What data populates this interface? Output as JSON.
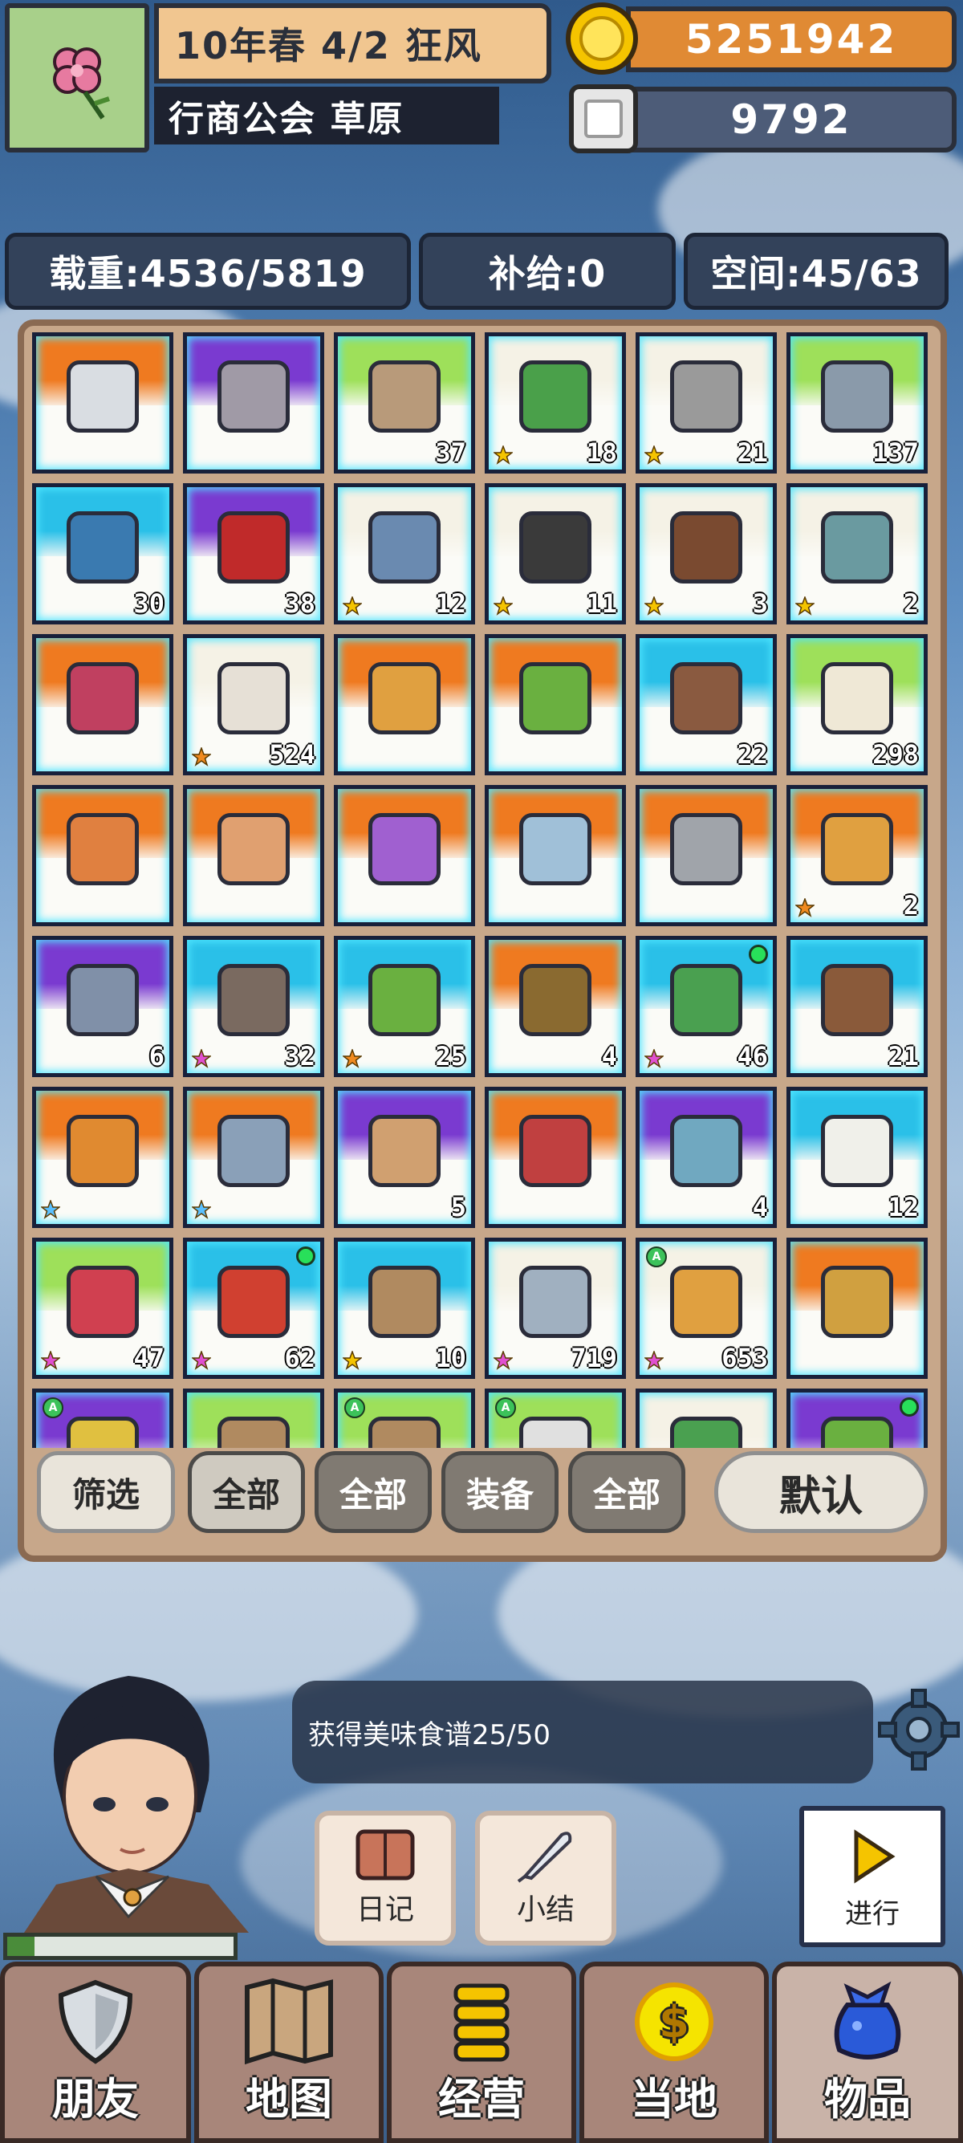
{
  "header": {
    "date_weather": "10年春 4/2 狂风",
    "location": "行商公会 草原",
    "gold": "5251942",
    "silver": "9792"
  },
  "stats": {
    "weight": "载重:4536/5819",
    "supply": "补给:0",
    "space": "空间:45/63"
  },
  "inventory": {
    "items": [
      {
        "count": "",
        "star": "",
        "dot": false,
        "a": false,
        "top": "#ef7a20",
        "icon": "#d9dde2",
        "name": "ring-item"
      },
      {
        "count": "",
        "star": "",
        "dot": false,
        "a": false,
        "top": "#7a3ad0",
        "icon": "#a09aa6",
        "name": "scroll-item"
      },
      {
        "count": "37",
        "star": "",
        "dot": false,
        "a": false,
        "top": "#9ee05a",
        "icon": "#b89a7a",
        "name": "rune-stone-item"
      },
      {
        "count": "18",
        "star": "gold",
        "dot": false,
        "a": false,
        "top": "#f5f2e6",
        "icon": "#4aa04a",
        "name": "book-item"
      },
      {
        "count": "21",
        "star": "gold",
        "dot": false,
        "a": false,
        "top": "#f5f2e6",
        "icon": "#9a9a9a",
        "name": "safe-item"
      },
      {
        "count": "137",
        "star": "",
        "dot": false,
        "a": false,
        "top": "#9ee05a",
        "icon": "#8a9aaa",
        "name": "rune-stone-item"
      },
      {
        "count": "30",
        "star": "",
        "dot": false,
        "a": false,
        "top": "#2ac0e8",
        "icon": "#3a7ab0",
        "name": "ticket-item"
      },
      {
        "count": "38",
        "star": "",
        "dot": false,
        "a": false,
        "top": "#7a3ad0",
        "icon": "#c02a2a",
        "name": "scroll-item"
      },
      {
        "count": "12",
        "star": "gold",
        "dot": false,
        "a": false,
        "top": "#f5f2e6",
        "icon": "#6a8ab0",
        "name": "book-item"
      },
      {
        "count": "11",
        "star": "gold",
        "dot": false,
        "a": false,
        "top": "#f5f2e6",
        "icon": "#3a3a3a",
        "name": "book-item"
      },
      {
        "count": "3",
        "star": "gold",
        "dot": false,
        "a": false,
        "top": "#f5f2e6",
        "icon": "#7a4a30",
        "name": "book-item"
      },
      {
        "count": "2",
        "star": "gold",
        "dot": false,
        "a": false,
        "top": "#f5f2e6",
        "icon": "#6a9aa0",
        "name": "book-item"
      },
      {
        "count": "",
        "star": "",
        "dot": false,
        "a": false,
        "top": "#ef7a20",
        "icon": "#c04060",
        "name": "ring-item"
      },
      {
        "count": "524",
        "star": "orange",
        "dot": false,
        "a": false,
        "top": "#f5f2e6",
        "icon": "#e6e0d6",
        "name": "medkit-item"
      },
      {
        "count": "",
        "star": "",
        "dot": false,
        "a": false,
        "top": "#ef7a20",
        "icon": "#e0a040",
        "name": "scroll-item"
      },
      {
        "count": "",
        "star": "",
        "dot": false,
        "a": false,
        "top": "#ef7a20",
        "icon": "#6ab040",
        "name": "ring-item"
      },
      {
        "count": "22",
        "star": "",
        "dot": false,
        "a": false,
        "top": "#2ac0e8",
        "icon": "#8a5a40",
        "name": "shell-item"
      },
      {
        "count": "298",
        "star": "",
        "dot": false,
        "a": false,
        "top": "#9ee05a",
        "icon": "#efe8d6",
        "name": "note-item"
      },
      {
        "count": "",
        "star": "",
        "dot": false,
        "a": false,
        "top": "#ef7a20",
        "icon": "#e08040",
        "name": "ring-item"
      },
      {
        "count": "",
        "star": "",
        "dot": false,
        "a": false,
        "top": "#ef7a20",
        "icon": "#e0a070",
        "name": "ring-item"
      },
      {
        "count": "",
        "star": "",
        "dot": false,
        "a": false,
        "top": "#ef7a20",
        "icon": "#a060d0",
        "name": "ring-item"
      },
      {
        "count": "",
        "star": "",
        "dot": false,
        "a": false,
        "top": "#ef7a20",
        "icon": "#a0c0d8",
        "name": "ring-item"
      },
      {
        "count": "",
        "star": "",
        "dot": false,
        "a": false,
        "top": "#ef7a20",
        "icon": "#a0a4aa",
        "name": "ring-item"
      },
      {
        "count": "2",
        "star": "orange",
        "dot": false,
        "a": false,
        "top": "#ef7a20",
        "icon": "#e0a040",
        "name": "ring-item"
      },
      {
        "count": "6",
        "star": "",
        "dot": false,
        "a": false,
        "top": "#7a3ad0",
        "icon": "#8090a8",
        "name": "scroll-item"
      },
      {
        "count": "32",
        "star": "rainbow",
        "dot": false,
        "a": false,
        "top": "#2ac0e8",
        "icon": "#7a6a60",
        "name": "ore-item"
      },
      {
        "count": "25",
        "star": "orange",
        "dot": false,
        "a": false,
        "top": "#2ac0e8",
        "icon": "#6ab040",
        "name": "scroll-item"
      },
      {
        "count": "4",
        "star": "",
        "dot": false,
        "a": false,
        "top": "#ef7a20",
        "icon": "#8a6a30",
        "name": "cloth-item"
      },
      {
        "count": "46",
        "star": "rainbow",
        "dot": true,
        "a": false,
        "top": "#2ac0e8",
        "icon": "#4aa050",
        "name": "bundle-item"
      },
      {
        "count": "21",
        "star": "",
        "dot": false,
        "a": false,
        "top": "#2ac0e8",
        "icon": "#8a5a3a",
        "name": "basket-item"
      },
      {
        "count": "",
        "star": "blue",
        "dot": false,
        "a": false,
        "top": "#ef7a20",
        "icon": "#e08a30",
        "name": "sword-item"
      },
      {
        "count": "",
        "star": "blue",
        "dot": false,
        "a": false,
        "top": "#ef7a20",
        "icon": "#8aa0b8",
        "name": "sword-item"
      },
      {
        "count": "5",
        "star": "",
        "dot": false,
        "a": false,
        "top": "#7a3ad0",
        "icon": "#d0a070",
        "name": "compass-item"
      },
      {
        "count": "",
        "star": "",
        "dot": false,
        "a": false,
        "top": "#ef7a20",
        "icon": "#c04040",
        "name": "ring-item"
      },
      {
        "count": "4",
        "star": "",
        "dot": false,
        "a": false,
        "top": "#7a3ad0",
        "icon": "#70a8c0",
        "name": "scroll-item"
      },
      {
        "count": "12",
        "star": "",
        "dot": false,
        "a": false,
        "top": "#2ac0e8",
        "icon": "#f0f0ea",
        "name": "cloth-item"
      },
      {
        "count": "47",
        "star": "rainbow",
        "dot": false,
        "a": false,
        "top": "#9ee05a",
        "icon": "#d04050",
        "name": "potion-item"
      },
      {
        "count": "62",
        "star": "rainbow",
        "dot": true,
        "a": false,
        "top": "#2ac0e8",
        "icon": "#d04030",
        "name": "jar-item"
      },
      {
        "count": "10",
        "star": "gold",
        "dot": false,
        "a": false,
        "top": "#2ac0e8",
        "icon": "#b08a60",
        "name": "scroll-item"
      },
      {
        "count": "719",
        "star": "rainbow",
        "dot": false,
        "a": false,
        "top": "#f5f2e6",
        "icon": "#a0b0c0",
        "name": "bucket-item"
      },
      {
        "count": "653",
        "star": "rainbow",
        "dot": false,
        "a": true,
        "top": "#f5f2e6",
        "icon": "#e0a040",
        "name": "bread-item"
      },
      {
        "count": "",
        "star": "",
        "dot": false,
        "a": false,
        "top": "#ef7a20",
        "icon": "#d0a040",
        "name": "emblem-item"
      },
      {
        "count": "",
        "star": "",
        "dot": false,
        "a": true,
        "top": "#7a3ad0",
        "icon": "#e0c040",
        "name": "item"
      },
      {
        "count": "",
        "star": "",
        "dot": false,
        "a": false,
        "top": "#9ee05a",
        "icon": "#b08a60",
        "name": "item"
      },
      {
        "count": "",
        "star": "",
        "dot": false,
        "a": true,
        "top": "#9ee05a",
        "icon": "#b08a60",
        "name": "item"
      },
      {
        "count": "",
        "star": "",
        "dot": false,
        "a": true,
        "top": "#9ee05a",
        "icon": "#e0e0e0",
        "name": "item"
      },
      {
        "count": "",
        "star": "",
        "dot": false,
        "a": false,
        "top": "#f5f2e6",
        "icon": "#4aa050",
        "name": "item"
      },
      {
        "count": "",
        "star": "",
        "dot": true,
        "a": false,
        "top": "#7a3ad0",
        "icon": "#6ab040",
        "name": "item"
      }
    ]
  },
  "filters": {
    "filter": "筛选",
    "all1": "全部",
    "all2": "全部",
    "equip": "装备",
    "all3": "全部",
    "default": "默认"
  },
  "message": "获得美味食谱25/50",
  "actions": {
    "diary": "日记",
    "summary": "小结",
    "proceed": "进行"
  },
  "player": {
    "hp_fraction": 0.12
  },
  "nav": {
    "friends": "朋友",
    "map": "地图",
    "business": "经营",
    "local": "当地",
    "items": "物品"
  }
}
